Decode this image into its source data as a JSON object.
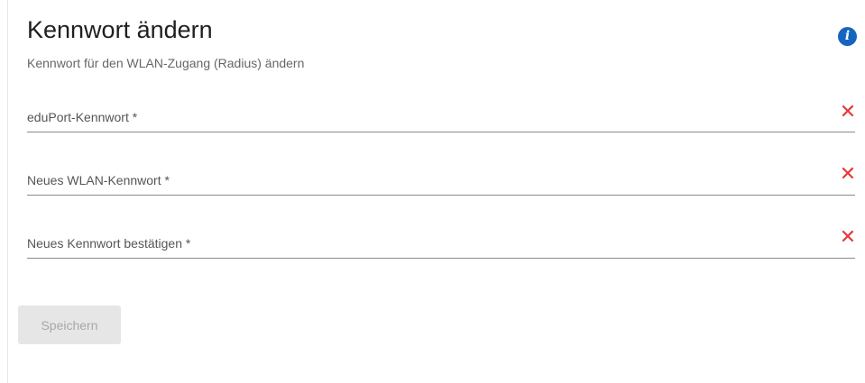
{
  "header": {
    "title": "Kennwort ändern",
    "subtitle": "Kennwort für den WLAN-Zugang (Radius) ändern",
    "info_icon": "info-icon"
  },
  "form": {
    "fields": [
      {
        "label": "eduPort-Kennwort *",
        "value": "",
        "clear_icon": "close-icon"
      },
      {
        "label": "Neues WLAN-Kennwort *",
        "value": "",
        "clear_icon": "close-icon"
      },
      {
        "label": "Neues Kennwort bestätigen *",
        "value": "",
        "clear_icon": "close-icon"
      }
    ],
    "save_label": "Speichern",
    "save_disabled": true
  },
  "colors": {
    "accent": "#1565c0",
    "error": "#e53935",
    "disabled_bg": "#e6e6e6",
    "disabled_text": "#a8a8a8"
  }
}
